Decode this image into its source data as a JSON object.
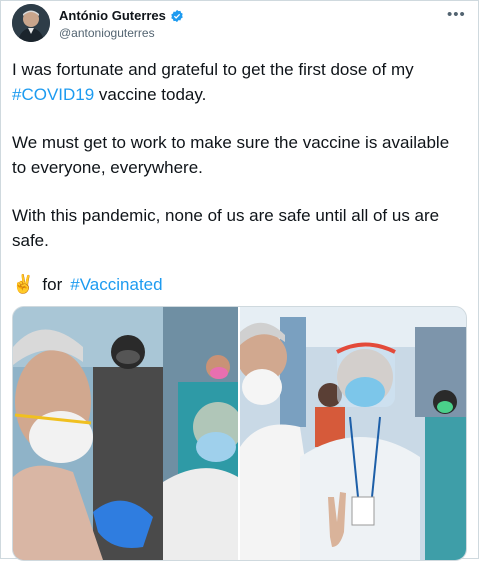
{
  "tweet": {
    "author_name": "António Guterres",
    "author_handle": "@antonioguterres",
    "paragraphs": [
      [
        "I was fortunate and grateful to get the first dose of my ",
        "#COVID19",
        " vaccine today."
      ],
      [
        "We must get to work to make sure the vaccine is available to everyone, everywhere."
      ],
      [
        "With this pandemic, none of us are safe until all of us are safe."
      ]
    ],
    "for_emoji": "✌",
    "for_text": "for",
    "for_hashtag": "#Vaccinated"
  },
  "icons": {
    "verified": "verified-badge-icon",
    "more": "more-options-icon"
  },
  "colors": {
    "link": "#1d9bf0",
    "text": "#0f1419",
    "secondary": "#536471",
    "verified": "#1d9bf0"
  }
}
